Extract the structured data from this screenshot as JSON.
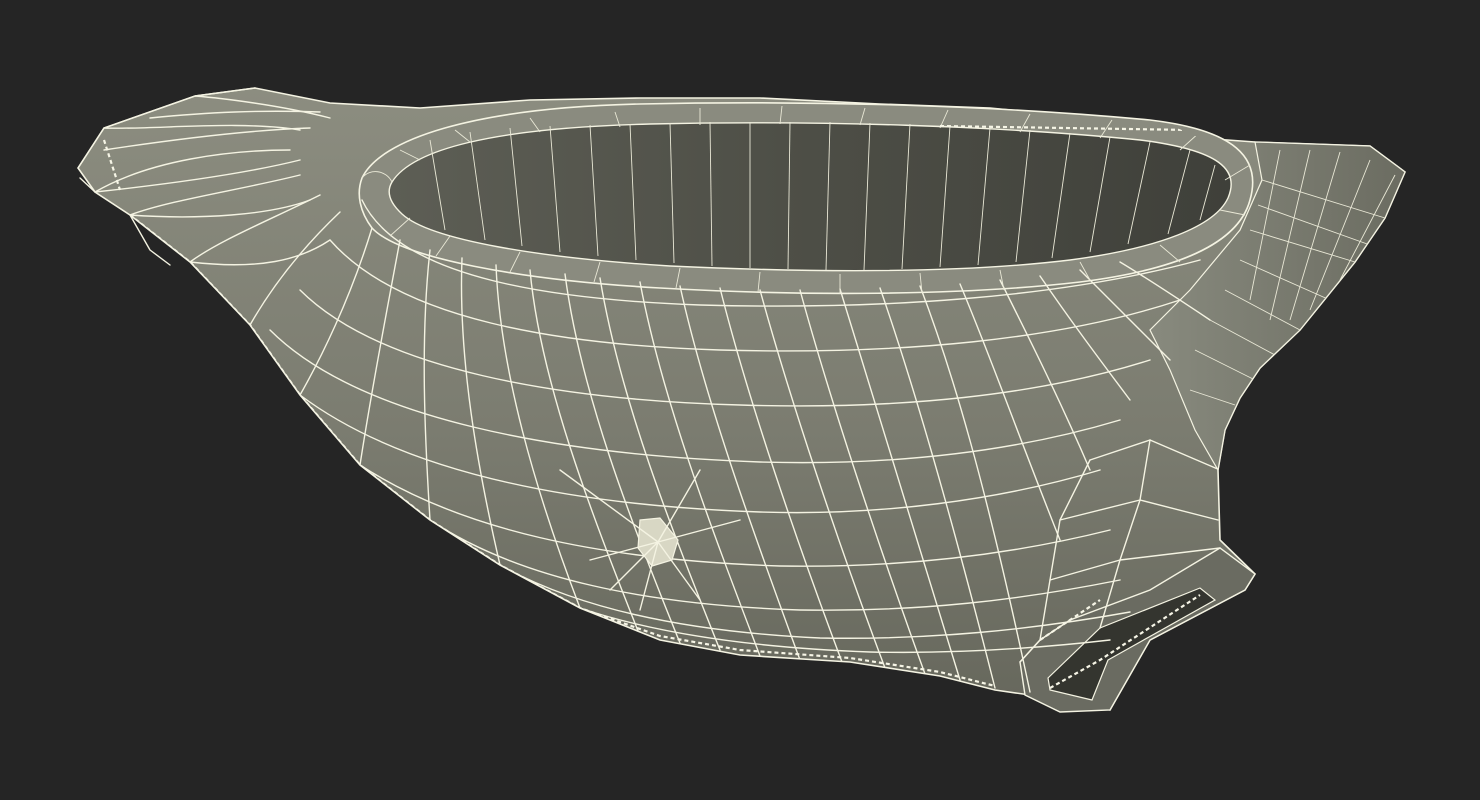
{
  "scene": {
    "subject": "toilet-bowl-wireframe",
    "colors": {
      "background": "#252525",
      "surface": "#7a7b6e",
      "surface_dark": "#5c5d53",
      "interior": "#4e4f47",
      "wire": "#f4f3e2"
    }
  }
}
